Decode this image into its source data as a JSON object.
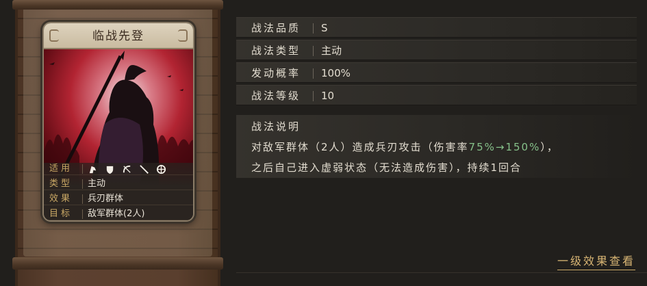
{
  "card": {
    "title": "临战先登",
    "stats": [
      {
        "label": "适用",
        "value": ""
      },
      {
        "label": "类型",
        "value": "主动"
      },
      {
        "label": "效果",
        "value": "兵刃群体"
      },
      {
        "label": "目标",
        "value": "敌军群体(2人)"
      }
    ],
    "unit_icons": [
      "cavalry-icon",
      "shield-icon",
      "bow-icon",
      "spear-icon",
      "chariot-icon"
    ]
  },
  "attributes": [
    {
      "label": "战法品质",
      "value": "S"
    },
    {
      "label": "战法类型",
      "value": "主动"
    },
    {
      "label": "发动概率",
      "value": "100%"
    },
    {
      "label": "战法等级",
      "value": "10"
    }
  ],
  "description": {
    "title": "战法说明",
    "line1_before": "对敌军群体（2人）造成兵刃攻击（伤害率",
    "line1_highlight": "75%→150%",
    "line1_after": "），",
    "line2": "之后自己进入虚弱状态（无法造成伤害），持续1回合"
  },
  "effect_link": "一级效果查看",
  "colors": {
    "background": "#211f1c",
    "gold": "#c9a865",
    "highlight_green": "#86c18a",
    "art_red": "#b22432"
  }
}
